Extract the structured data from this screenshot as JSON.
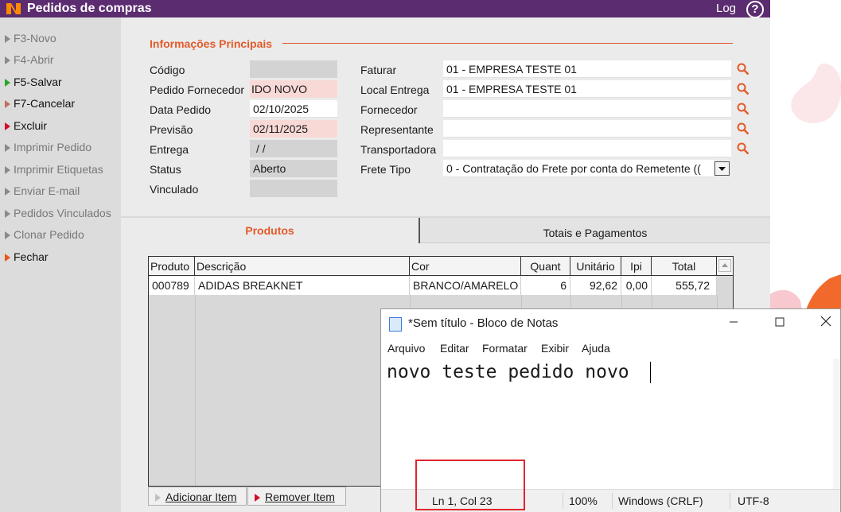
{
  "window": {
    "title": "Pedidos de compras",
    "log_label": "Log",
    "help_label": "?"
  },
  "sidebar": {
    "items": [
      {
        "label": "F3-Novo"
      },
      {
        "label": "F4-Abrir"
      },
      {
        "label": "F5-Salvar"
      },
      {
        "label": "F7-Cancelar"
      },
      {
        "label": "Excluir"
      },
      {
        "label": "Imprimir Pedido"
      },
      {
        "label": "Imprimir Etiquetas"
      },
      {
        "label": "Enviar E-mail"
      },
      {
        "label": "Pedidos Vinculados"
      },
      {
        "label": "Clonar Pedido"
      },
      {
        "label": "Fechar"
      }
    ]
  },
  "form": {
    "section_title": "Informações Principais",
    "left": {
      "codigo_label": "Código",
      "codigo_value": "",
      "pedido_fornecedor_label": "Pedido Fornecedor",
      "pedido_fornecedor_value": "IDO NOVO",
      "data_pedido_label": "Data Pedido",
      "data_pedido_value": "02/10/2025",
      "previsao_label": "Previsão",
      "previsao_value": "02/11/2025",
      "entrega_label": "Entrega",
      "entrega_value": " /  /",
      "status_label": "Status",
      "status_value": "Aberto",
      "vinculado_label": "Vinculado",
      "vinculado_value": ""
    },
    "right": {
      "faturar_label": "Faturar",
      "faturar_value": "01 - EMPRESA TESTE  01",
      "local_entrega_label": "Local Entrega",
      "local_entrega_value": "01 - EMPRESA TESTE  01",
      "fornecedor_label": "Fornecedor",
      "fornecedor_value": "",
      "representante_label": "Representante",
      "representante_value": "",
      "transportadora_label": "Transportadora",
      "transportadora_value": "",
      "frete_tipo_label": "Frete Tipo",
      "frete_tipo_value": "0 - Contratação do Frete por conta do Remetente (("
    }
  },
  "tabs": [
    {
      "label": "Produtos"
    },
    {
      "label": "Totais e Pagamentos"
    }
  ],
  "grid": {
    "headers": [
      "Produto",
      "Descrição",
      "Cor",
      "Quant",
      "Unitário",
      "Ipi",
      "Total"
    ],
    "rows": [
      {
        "produto": "000789",
        "descricao": "ADIDAS BREAKNET",
        "cor": "BRANCO/AMARELO",
        "quant": "6",
        "unitario": "92,62",
        "ipi": "0,00",
        "total": "555,72"
      }
    ]
  },
  "buttons": {
    "add_item": "Adicionar Item",
    "remove_item": "Remover Item"
  },
  "notepad": {
    "title": "*Sem título - Bloco de Notas",
    "menu": [
      "Arquivo",
      "Editar",
      "Formatar",
      "Exibir",
      "Ajuda"
    ],
    "content": "novo teste pedido novo",
    "status": {
      "position": "Ln 1, Col 23",
      "zoom": "100%",
      "line_ending": "Windows (CRLF)",
      "encoding": "UTF-8"
    }
  },
  "colors": {
    "titlebar": "#5b2c6f",
    "accent": "#e35a2a",
    "highlight_box": "#e0262e"
  }
}
